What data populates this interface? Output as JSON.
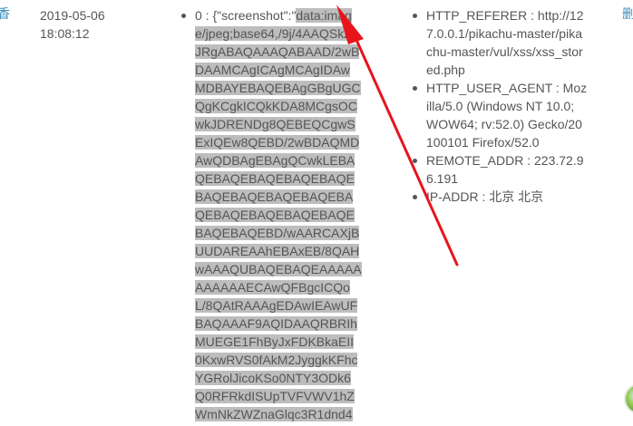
{
  "left_edge_char": "香",
  "right_edge_char": "删",
  "row": {
    "date": "2019-05-06",
    "time": "18:08:12",
    "data_prefix": "0 : {\"screenshot\":\"",
    "data_lines": [
      "data:imag",
      "e/jpeg;base64,/9j/4AAQSkZ",
      "JRgABAQAAAQABAAD/2wB",
      "DAAMCAgICAgMCAgIDAw",
      "MDBAYEBAQEBAgGBgUGC",
      "QgKCgkICQkKDA8MCgsOC",
      "wkJDRENDg8QEBEQCgwS",
      "ExIQEw8QEBD/2wBDAQMD",
      "AwQDBAgEBAgQCwkLEBA",
      "QEBAQEBAQEBAQEBAQE",
      "BAQEBAQEBAQEBAQEBA",
      "QEBAQEBAQEBAQEBAQE",
      "BAQEBAQEBD/wAARCAXjB",
      "UUDAREAAhEBAxEB/8QAH",
      "wAAAQUBAQEBAQEAAAAA",
      "AAAAAAECAwQFBgcICQo",
      "L/8QAtRAAAgEDAwIEAwUF",
      "BAQAAAF9AQIDAAQRBRIh",
      "MUEGE1FhByJxFDKBkaEII",
      "0KxwRVS0fAkM2JyggkKFhc",
      "YGRolJicoKSo0NTY3ODk6",
      "Q0RFRkdISUpTVFVWV1hZ",
      "WmNkZWZnaGlqc3R1dnd4"
    ],
    "headers": [
      {
        "lines": [
          "HTTP_REFERER : http://12",
          "7.0.0.1/pikachu-master/pika",
          "chu-master/vul/xss/xss_stor",
          "ed.php"
        ]
      },
      {
        "lines": [
          "HTTP_USER_AGENT : Moz",
          "illa/5.0 (Windows NT 10.0;",
          "WOW64; rv:52.0) Gecko/20",
          "100101 Firefox/52.0"
        ]
      },
      {
        "lines": [
          "REMOTE_ADDR : 223.72.9",
          "6.191"
        ]
      },
      {
        "lines": [
          "IP-ADDR : 北京 北京"
        ]
      }
    ]
  },
  "annotation": {
    "color": "#e8141c"
  }
}
